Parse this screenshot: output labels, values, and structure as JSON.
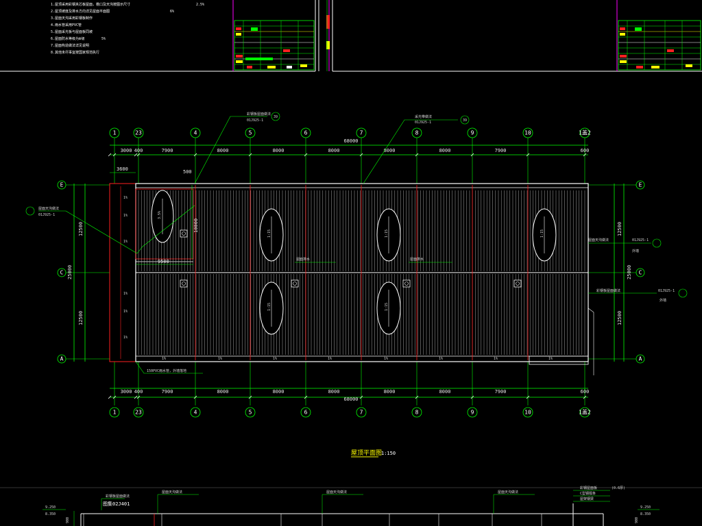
{
  "drawing": {
    "title": "屋顶平面图",
    "scale": "1:150"
  },
  "dimensions": {
    "overall": "68000",
    "top_segments": [
      "3000",
      "400",
      "7900",
      "8000",
      "8000",
      "8000",
      "8000",
      "8000",
      "7900",
      "600"
    ],
    "bottom_segments": [
      "3000",
      "400",
      "7900",
      "8000",
      "8000",
      "8000",
      "8000",
      "8000",
      "7900",
      "600"
    ],
    "left_vertical": [
      "12500",
      "25000",
      "12500"
    ],
    "right_vertical": [
      "12500",
      "25000",
      "12500"
    ],
    "inner": {
      "d_3600": "3600",
      "d_500": "500",
      "d_10000": "10000",
      "d_9500": "9500"
    }
  },
  "axes": {
    "columns": [
      "1",
      "23",
      "4",
      "5",
      "6",
      "7",
      "8",
      "9",
      "10",
      "1盖2"
    ],
    "rows": [
      "E",
      "C",
      "A"
    ]
  },
  "slopes": {
    "ellipse_label": "1:15",
    "small_label": "1%",
    "left_vertical_label": "3.5%"
  },
  "annotations": {
    "pvc_pipe": "150PVC雨水管，外墙落地",
    "standard_ref": "图集02J401",
    "roof_note": "屋面天沟做法",
    "ref_1": "01J925-1",
    "ref_2": "01J925-1",
    "ref_3": "01J925-1",
    "wall_note": "外墙",
    "ref_tag_1": "39",
    "ref_tag_2": "39",
    "callout_1": "彩钢板屋面做法",
    "callout_2": "采光带做法",
    "callout_3": "屋面排水",
    "section_elev_1": "9.250",
    "section_elev_2": "8.350",
    "section_elev_3": "9.250",
    "section_elev_4": "8.350",
    "section_dim": "900",
    "legend_1": "彩钢屋面板",
    "legend_2": "C型钢檩条",
    "legend_3": "屋架钢梁",
    "legend_4": "(0.6厚)"
  },
  "notes_top_left": [
    "1.屋顶采用彩钢夹芯板屋面，檐口及天沟按图示尺寸",
    "2.屋顶坡度及排水方向详见屋面平面图",
    "3.屋面天沟采用彩钢板制作",
    "4.雨水管采用PVC管",
    "5.屋面采光板与屋面板同坡",
    "6.屋面防水等级为Ⅲ级",
    "7.屋面构造做法详见说明",
    "8.其他未尽事宜按国家规范执行"
  ],
  "notes_values": [
    "2.5%",
    "5%",
    "6%"
  ],
  "colors": {
    "background": "#000000",
    "grid_green": "#00ff00",
    "wall_white": "#ffffff",
    "roof_gray": "#bfbfbf",
    "axis_red": "#ff2020",
    "title_yellow": "#ffff00",
    "border_magenta": "#ff00ff"
  }
}
